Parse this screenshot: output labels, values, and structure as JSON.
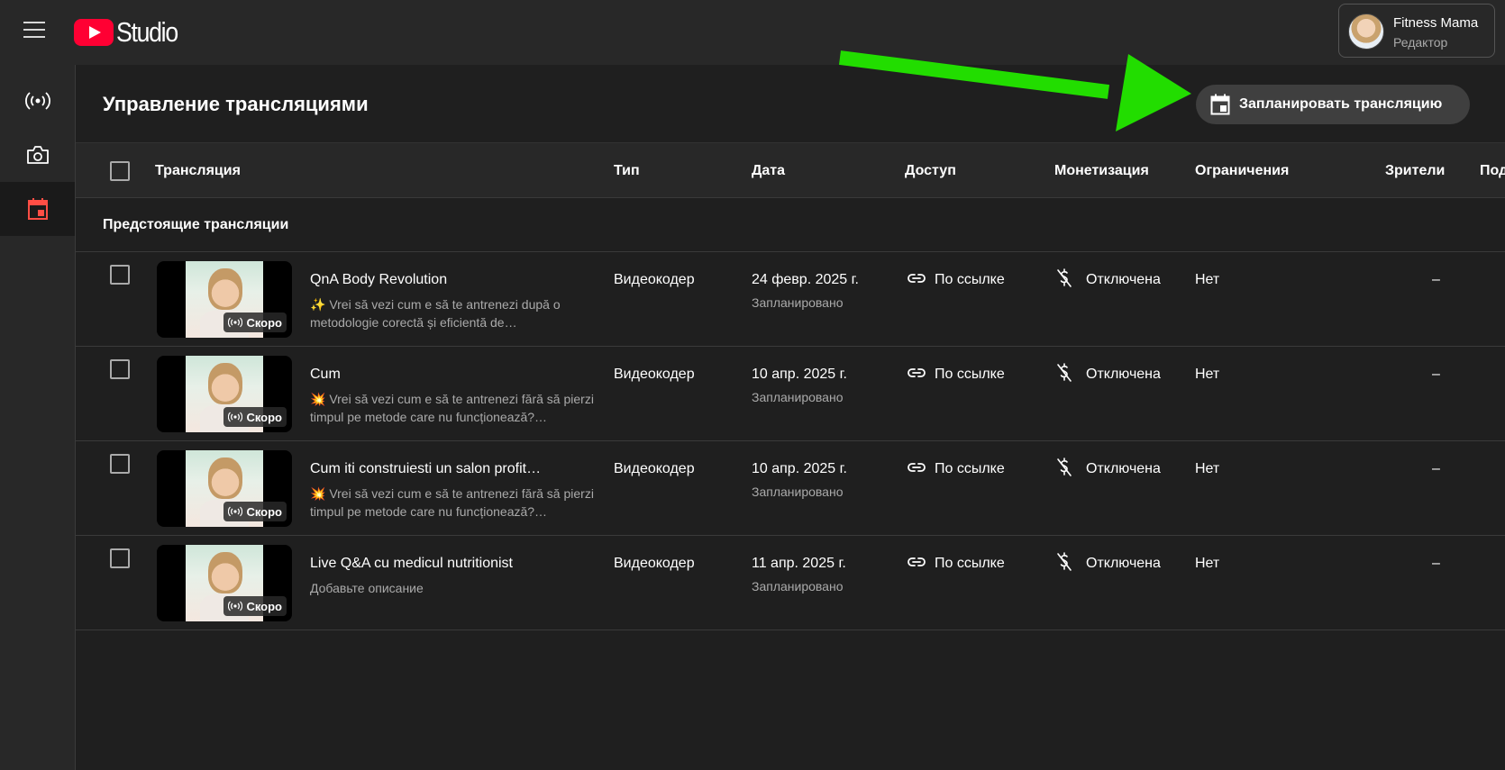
{
  "app": {
    "logo_text": "Studio",
    "account_name": "Fitness Mama",
    "account_role": "Редактор"
  },
  "page": {
    "title": "Управление трансляциями",
    "schedule_button": "Запланировать трансляцию",
    "section_title": "Предстоящие трансляции"
  },
  "table": {
    "columns": [
      "Трансляция",
      "Тип",
      "Дата",
      "Доступ",
      "Монетизация",
      "Ограничения",
      "Зрители",
      "Под"
    ],
    "rows": [
      {
        "title": "QnA Body Revolution",
        "description": "✨ Vrei să vezi cum e să te antrenezi după o metodologie corectă și eficientă de…",
        "badge": "Скоро",
        "type": "Видеокодер",
        "date": "24 февр. 2025 г.",
        "status": "Запланировано",
        "access": "По ссылке",
        "monetization": "Отключена",
        "restrictions": "Нет",
        "viewers": "–"
      },
      {
        "title": "Cum",
        "description": "💥 Vrei să vezi cum e să te antrenezi fără să pierzi timpul pe metode care nu funcționează?…",
        "badge": "Скоро",
        "type": "Видеокодер",
        "date": "10 апр. 2025 г.",
        "status": "Запланировано",
        "access": "По ссылке",
        "monetization": "Отключена",
        "restrictions": "Нет",
        "viewers": "–"
      },
      {
        "title": "Cum iti construiesti un salon profit…",
        "description": "💥 Vrei să vezi cum e să te antrenezi fără să pierzi timpul pe metode care nu funcționează?…",
        "badge": "Скоро",
        "type": "Видеокодер",
        "date": "10 апр. 2025 г.",
        "status": "Запланировано",
        "access": "По ссылке",
        "monetization": "Отключена",
        "restrictions": "Нет",
        "viewers": "–"
      },
      {
        "title": "Live Q&A cu medicul nutritionist",
        "description": "Добавьте описание",
        "badge": "Скоро",
        "type": "Видеокодер",
        "date": "11 апр. 2025 г.",
        "status": "Запланировано",
        "access": "По ссылке",
        "monetization": "Отключена",
        "restrictions": "Нет",
        "viewers": "–"
      }
    ]
  },
  "icons": {
    "menu": "hamburger-menu-icon",
    "live": "live-broadcast-icon",
    "camera": "camera-icon",
    "calendar": "calendar-icon",
    "link": "link-icon",
    "monetization_off": "dollar-off-icon"
  },
  "colors": {
    "brand_red": "#ff0033",
    "active_icon": "#ff4e45",
    "annotation_arrow": "#22dd00"
  }
}
